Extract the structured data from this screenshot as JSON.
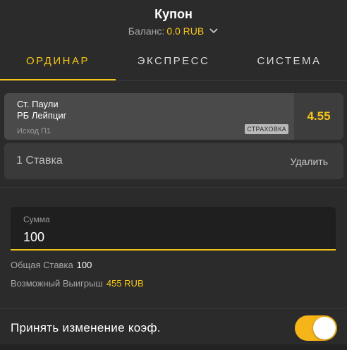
{
  "header": {
    "title": "Купон",
    "balance_label": "Баланс:",
    "balance_value": "0.0 RUB"
  },
  "tabs": [
    {
      "label": "ОРДИНАР",
      "active": true
    },
    {
      "label": "ЭКСПРЕСС",
      "active": false
    },
    {
      "label": "СИСТЕМА",
      "active": false
    }
  ],
  "bet": {
    "team_home": "Ст. Паули",
    "team_away": "РБ Лейпциг",
    "outcome": "Исход П1",
    "insurance": "СТРАХОВКА",
    "odds": "4.55"
  },
  "stake_summary": {
    "count": "1 Ставка",
    "delete_label": "Удалить"
  },
  "amount": {
    "label": "Сумма",
    "value": "100"
  },
  "totals": {
    "total_stake_label": "Общая Ставка",
    "total_stake_value": "100",
    "possible_win_label": "Возможный Выигрыш",
    "possible_win_value": "455 RUB"
  },
  "settings": {
    "accept_odds_label": "Принять изменение коэф.",
    "accept_odds_enabled": true
  },
  "colors": {
    "accent": "#f5c518",
    "background": "#2b2b2b"
  }
}
